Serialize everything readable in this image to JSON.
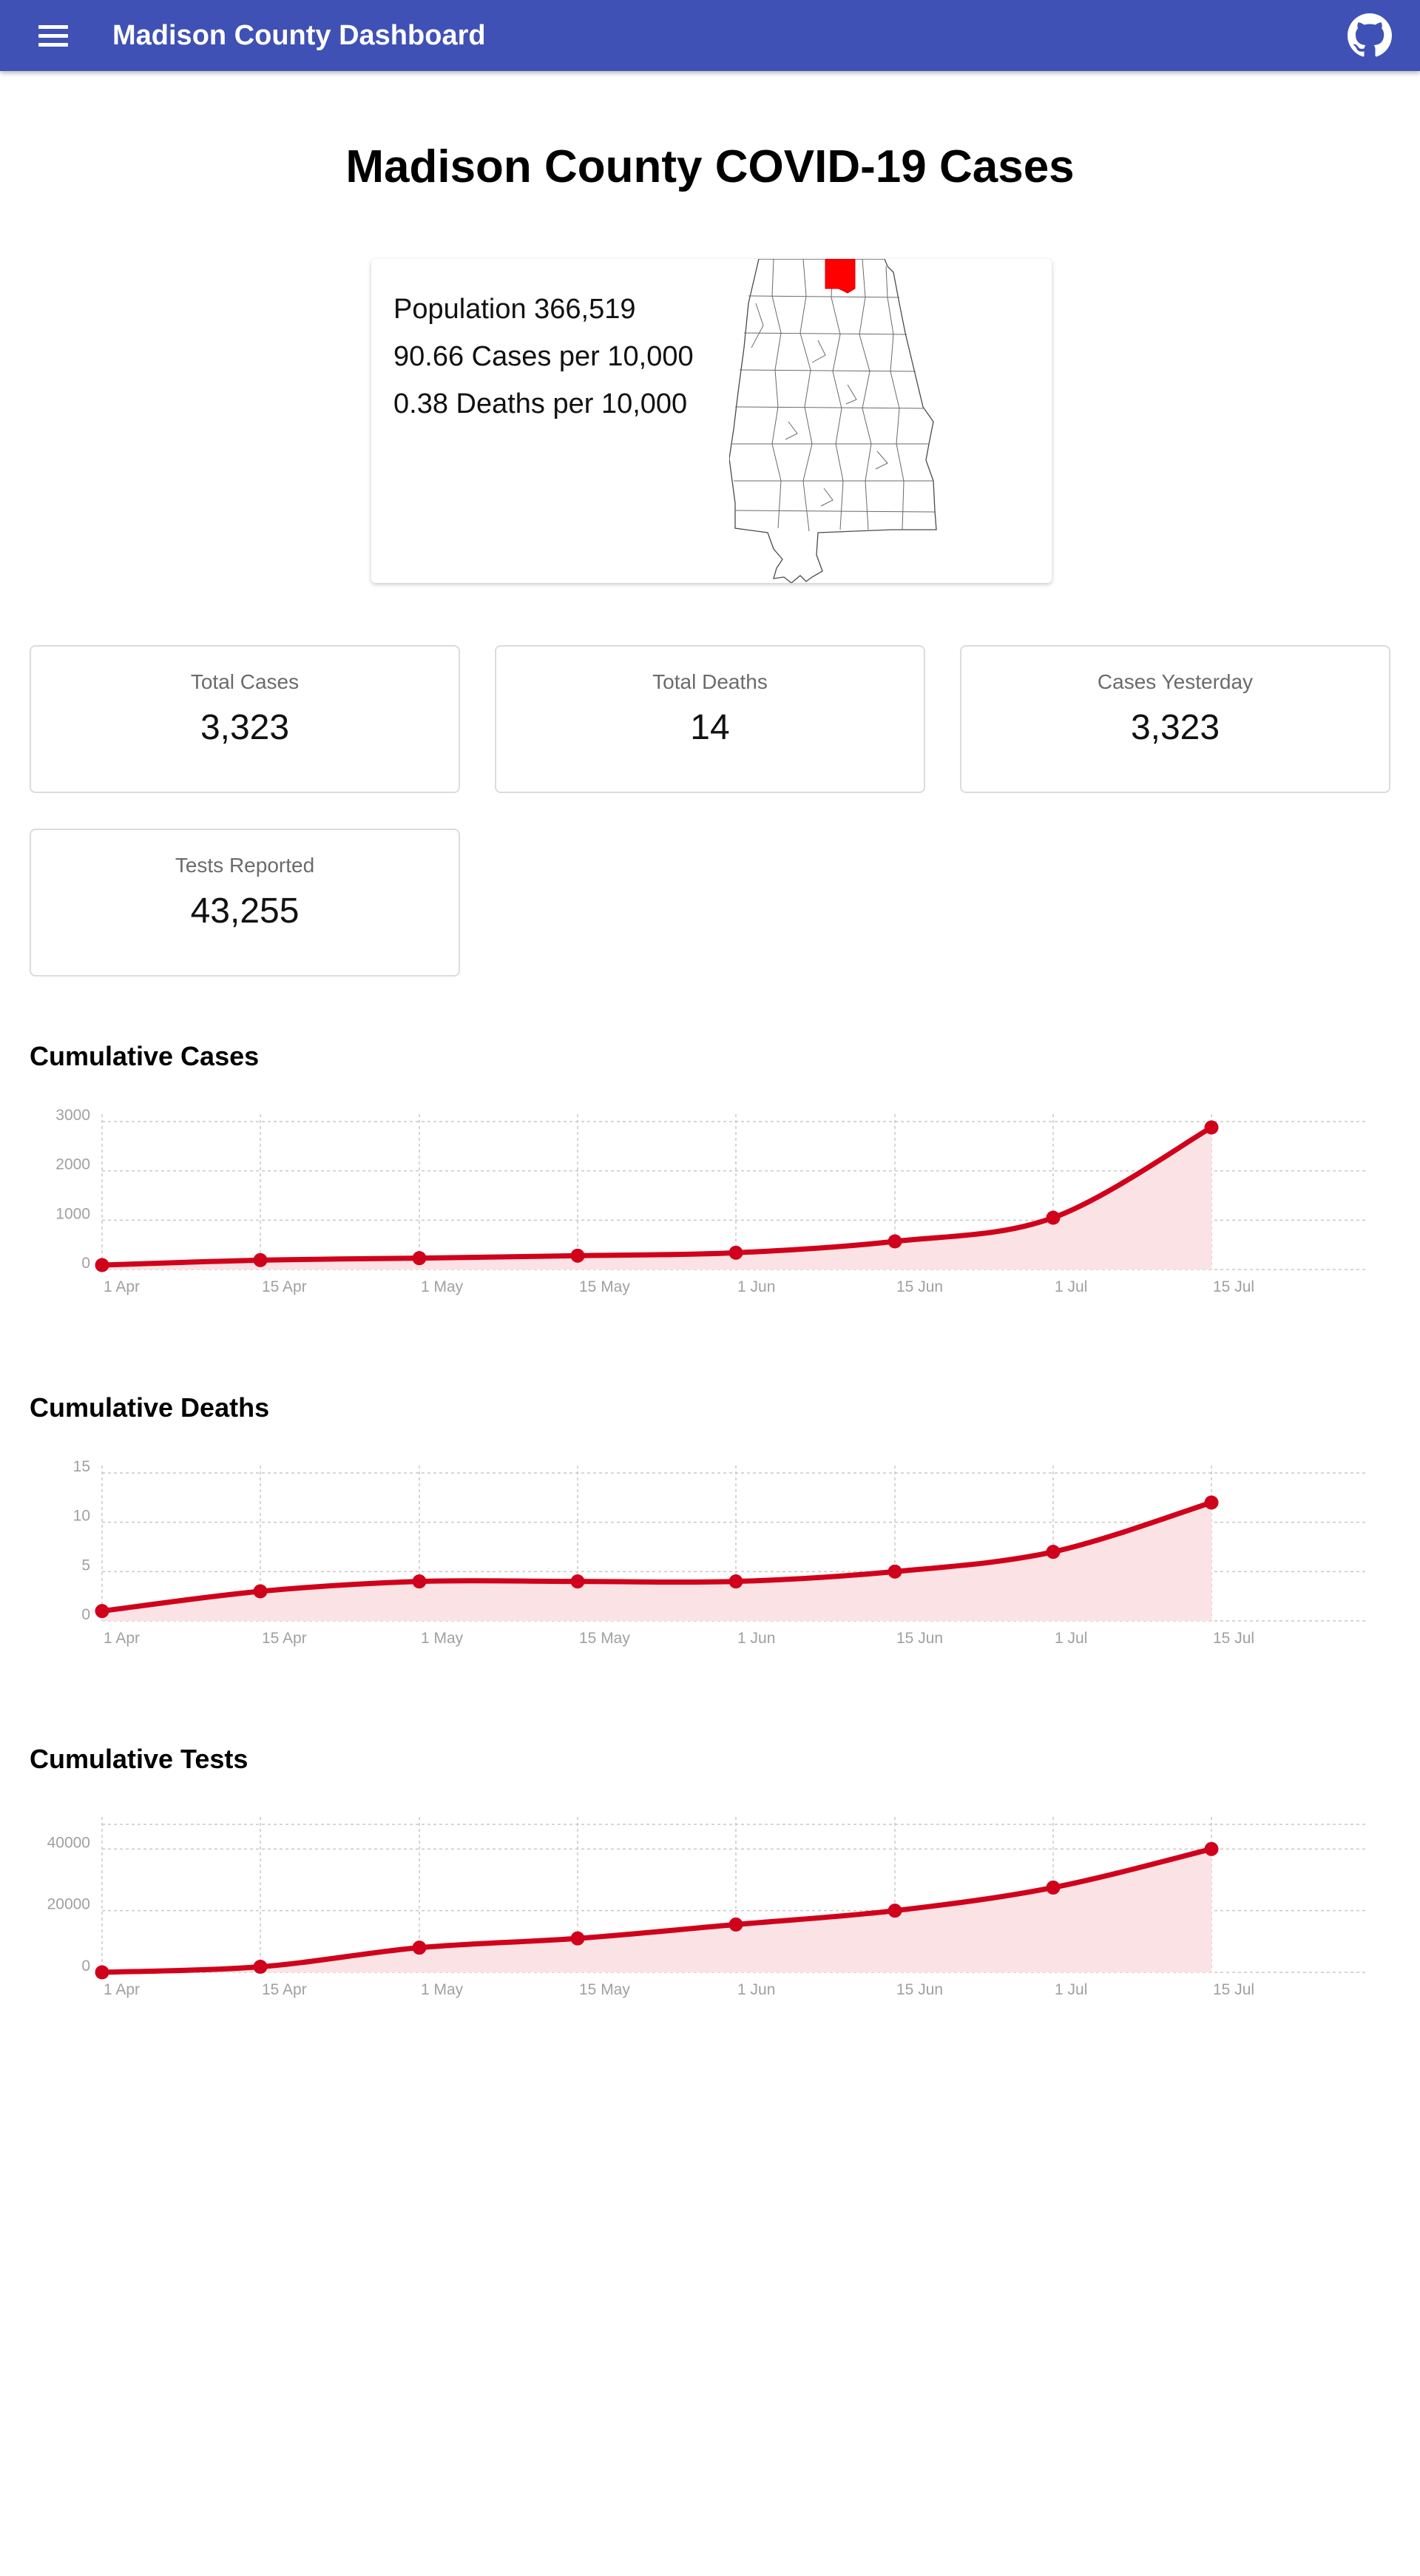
{
  "appbar": {
    "title": "Madison County Dashboard",
    "menu_icon": "menu-icon",
    "github_icon": "github-icon",
    "color": "#3f51b5"
  },
  "page_title": "Madison County COVID-19 Cases",
  "info": {
    "population": "Population 366,519",
    "cases_rate": "90.66 Cases per 10,000",
    "deaths_rate": "0.38 Deaths per 10,000",
    "highlight_color": "#ff0000"
  },
  "stats": [
    {
      "label": "Total Cases",
      "value": "3,323"
    },
    {
      "label": "Total Deaths",
      "value": "14"
    },
    {
      "label": "Cases Yesterday",
      "value": "3,323"
    },
    {
      "label": "Tests Reported",
      "value": "43,255"
    }
  ],
  "sections": {
    "cases": "Cumulative Cases",
    "deaths": "Cumulative Deaths",
    "tests": "Cumulative Tests"
  },
  "chart_data": [
    {
      "type": "area",
      "title": "Cumulative Cases",
      "x": [
        "2020-04-01",
        "2020-04-15",
        "2020-05-01",
        "2020-05-15",
        "2020-06-01",
        "2020-06-15",
        "2020-07-01",
        "2020-07-15"
      ],
      "y": [
        90,
        190,
        230,
        280,
        340,
        570,
        1050,
        2880
      ],
      "x_ticks": [
        "1 Apr",
        "15 Apr",
        "1 May",
        "15 May",
        "1 Jun",
        "15 Jun",
        "1 Jul",
        "15 Jul"
      ],
      "y_ticks": [
        0,
        1000,
        2000,
        3000
      ],
      "ylim": [
        0,
        3000
      ],
      "line_color": "#d0021b",
      "fill_color": "#fbe3e5",
      "grid": true
    },
    {
      "type": "area",
      "title": "Cumulative Deaths",
      "x": [
        "2020-04-01",
        "2020-04-15",
        "2020-05-01",
        "2020-05-15",
        "2020-06-01",
        "2020-06-15",
        "2020-07-01",
        "2020-07-15"
      ],
      "y": [
        1,
        3,
        4,
        4,
        4,
        5,
        7,
        12
      ],
      "x_ticks": [
        "1 Apr",
        "15 Apr",
        "1 May",
        "15 May",
        "1 Jun",
        "15 Jun",
        "1 Jul",
        "15 Jul"
      ],
      "y_ticks": [
        0,
        5,
        10,
        15
      ],
      "ylim": [
        0,
        15
      ],
      "line_color": "#d0021b",
      "fill_color": "#fbe3e5",
      "grid": true
    },
    {
      "type": "area",
      "title": "Cumulative Tests",
      "x": [
        "2020-04-01",
        "2020-04-15",
        "2020-05-01",
        "2020-05-15",
        "2020-06-01",
        "2020-06-15",
        "2020-07-01",
        "2020-07-15"
      ],
      "y": [
        0,
        1800,
        8000,
        11000,
        15500,
        20000,
        27500,
        40000
      ],
      "x_ticks": [
        "1 Apr",
        "15 Apr",
        "1 May",
        "15 May",
        "1 Jun",
        "15 Jun",
        "1 Jul",
        "15 Jul"
      ],
      "y_ticks": [
        0,
        20000,
        40000
      ],
      "ylim": [
        0,
        48000
      ],
      "line_color": "#d0021b",
      "fill_color": "#fbe3e5",
      "grid": true
    }
  ]
}
